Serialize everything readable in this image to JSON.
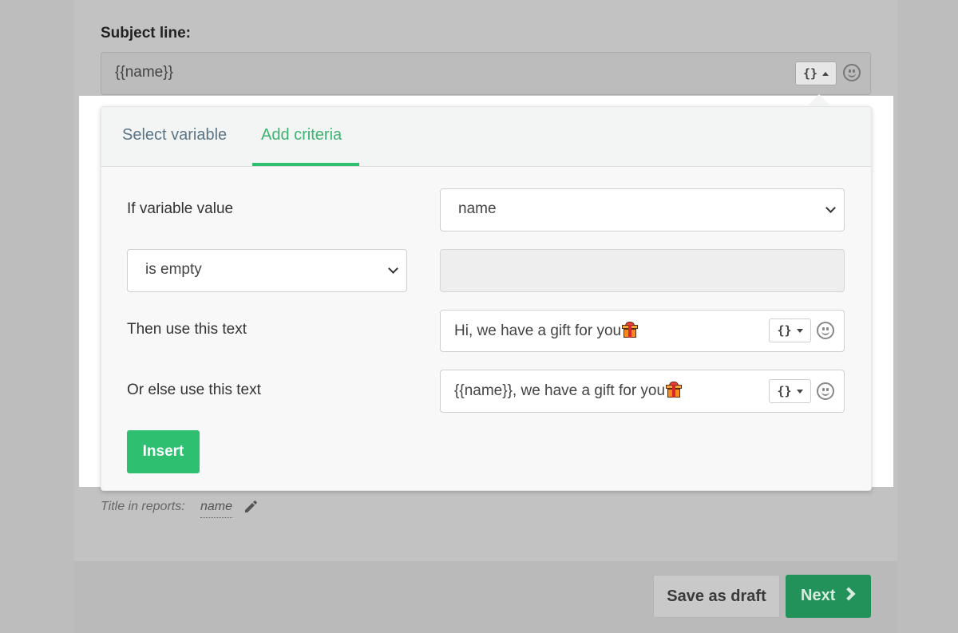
{
  "subject": {
    "label": "Subject line:",
    "value": "{{name}}",
    "variable_button": "{}"
  },
  "popup": {
    "tabs": [
      {
        "label": "Select variable",
        "active": false
      },
      {
        "label": "Add criteria",
        "active": true
      }
    ],
    "if_label": "If variable value",
    "variable_select": "name",
    "condition_select": "is empty",
    "then_label": "Then use this text",
    "then_value": "Hi, we have a gift for you",
    "else_label": "Or else use this text",
    "else_value": "{{name}}, we have a gift for you",
    "variable_button": "{}",
    "insert_label": "Insert"
  },
  "reports": {
    "label": "Title in reports:",
    "value": "name"
  },
  "footer": {
    "draft_label": "Save as draft",
    "next_label": "Next"
  },
  "colors": {
    "accent": "#2fbf71",
    "next_button": "#23915a",
    "tab_inactive": "#5b7486"
  },
  "icons": [
    "emoji-smile-icon",
    "gift-icon",
    "chevron-down-icon",
    "caret-icon",
    "pencil-icon",
    "chevron-right-icon"
  ]
}
